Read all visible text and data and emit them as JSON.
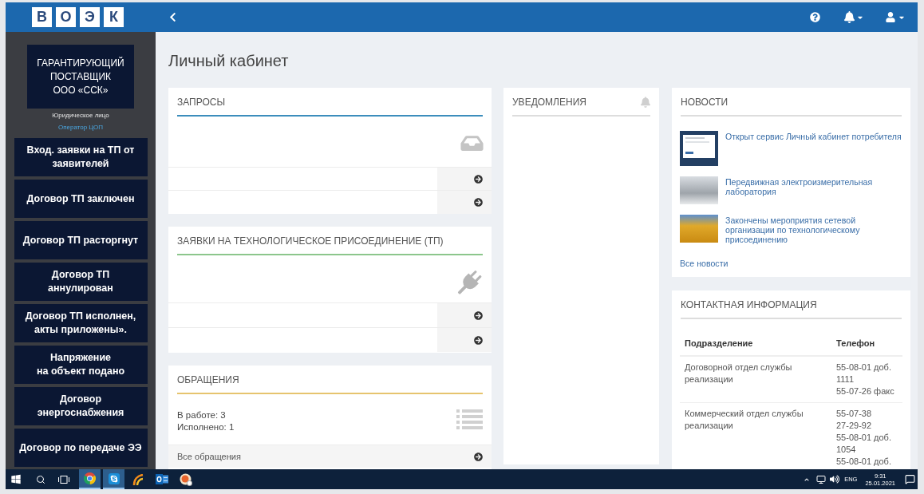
{
  "header": {
    "logo": [
      "В",
      "О",
      "Э",
      "К"
    ]
  },
  "sidebar": {
    "organization": "ГАРАНТИРУЮЩИЙ\nПОСТАВЩИК\nООО «ССК»",
    "account_type": "Юридическое лицо",
    "role": "Оператор ЦОП",
    "items": [
      "Вход. заявки на ТП от\nзаявителей",
      "Договор ТП заключен",
      "Договор ТП расторгнут",
      "Договор ТП\nаннулирован",
      "Договор ТП исполнен,\nакты приложены».",
      "Напряжение\nна объект подано",
      "Договор\nэнергоснабжения",
      "Договор по передаче ЭЭ"
    ]
  },
  "page_title": "Личный кабинет",
  "requests": {
    "title": "ЗАПРОСЫ",
    "color": "#3c8dbc",
    "rows": [
      {
        "kind": "link"
      },
      {
        "kind": "link"
      }
    ]
  },
  "connection_requests": {
    "title": "ЗАЯВКИ НА ТЕХНОЛОГИЧЕСКОЕ ПРИСОЕДИНЕНИЕ (ТП)",
    "color": "#8cc68c",
    "rows": [
      {
        "kind": "link"
      },
      {
        "kind": "link"
      }
    ]
  },
  "appeals": {
    "title": "ОБРАЩЕНИЯ",
    "color": "#e6c46e",
    "stats": [
      "В работе: 3",
      "Исполнено: 1"
    ],
    "footer_link": "Все обращения"
  },
  "notifications": {
    "title": "УВЕДОМЛЕНИЯ",
    "color": "#dddddd"
  },
  "news": {
    "title": "НОВОСТИ",
    "color": "#dddddd",
    "items": [
      {
        "kind": "screenshot",
        "title": "Открыт сервис Личный кабинет потребителя"
      },
      {
        "kind": "photo",
        "title": "Передвижная электроизмерительная лаборатория"
      },
      {
        "kind": "photo",
        "title": "Закончены мероприятия сетевой организации по технологическому присоединению"
      }
    ],
    "all_link": "Все новости"
  },
  "contacts": {
    "title": "КОНТАКТНАЯ ИНФОРМАЦИЯ",
    "color": "#dddddd",
    "columns": [
      "Подразделение",
      "Телефон"
    ],
    "rows": [
      {
        "department": "Договорной отдел службы реализации",
        "phones": [
          "55-08-01 доб. 1111",
          "55-07-26 факс"
        ]
      },
      {
        "department": "Коммерческий отдел службы реализации",
        "phones": [
          "55-07-38",
          "27-29-92",
          "55-08-01 доб. 1054",
          "55-08-01 доб."
        ]
      }
    ]
  },
  "taskbar": {
    "apps": [
      {
        "kind": "browser",
        "active": true
      },
      {
        "kind": "messenger",
        "active": true
      },
      {
        "kind": "swirl",
        "active": false
      },
      {
        "kind": "mail",
        "active": false
      },
      {
        "kind": "round",
        "active": false
      }
    ],
    "language": "ENG",
    "time": "9:31",
    "date": "25.01.2021"
  }
}
